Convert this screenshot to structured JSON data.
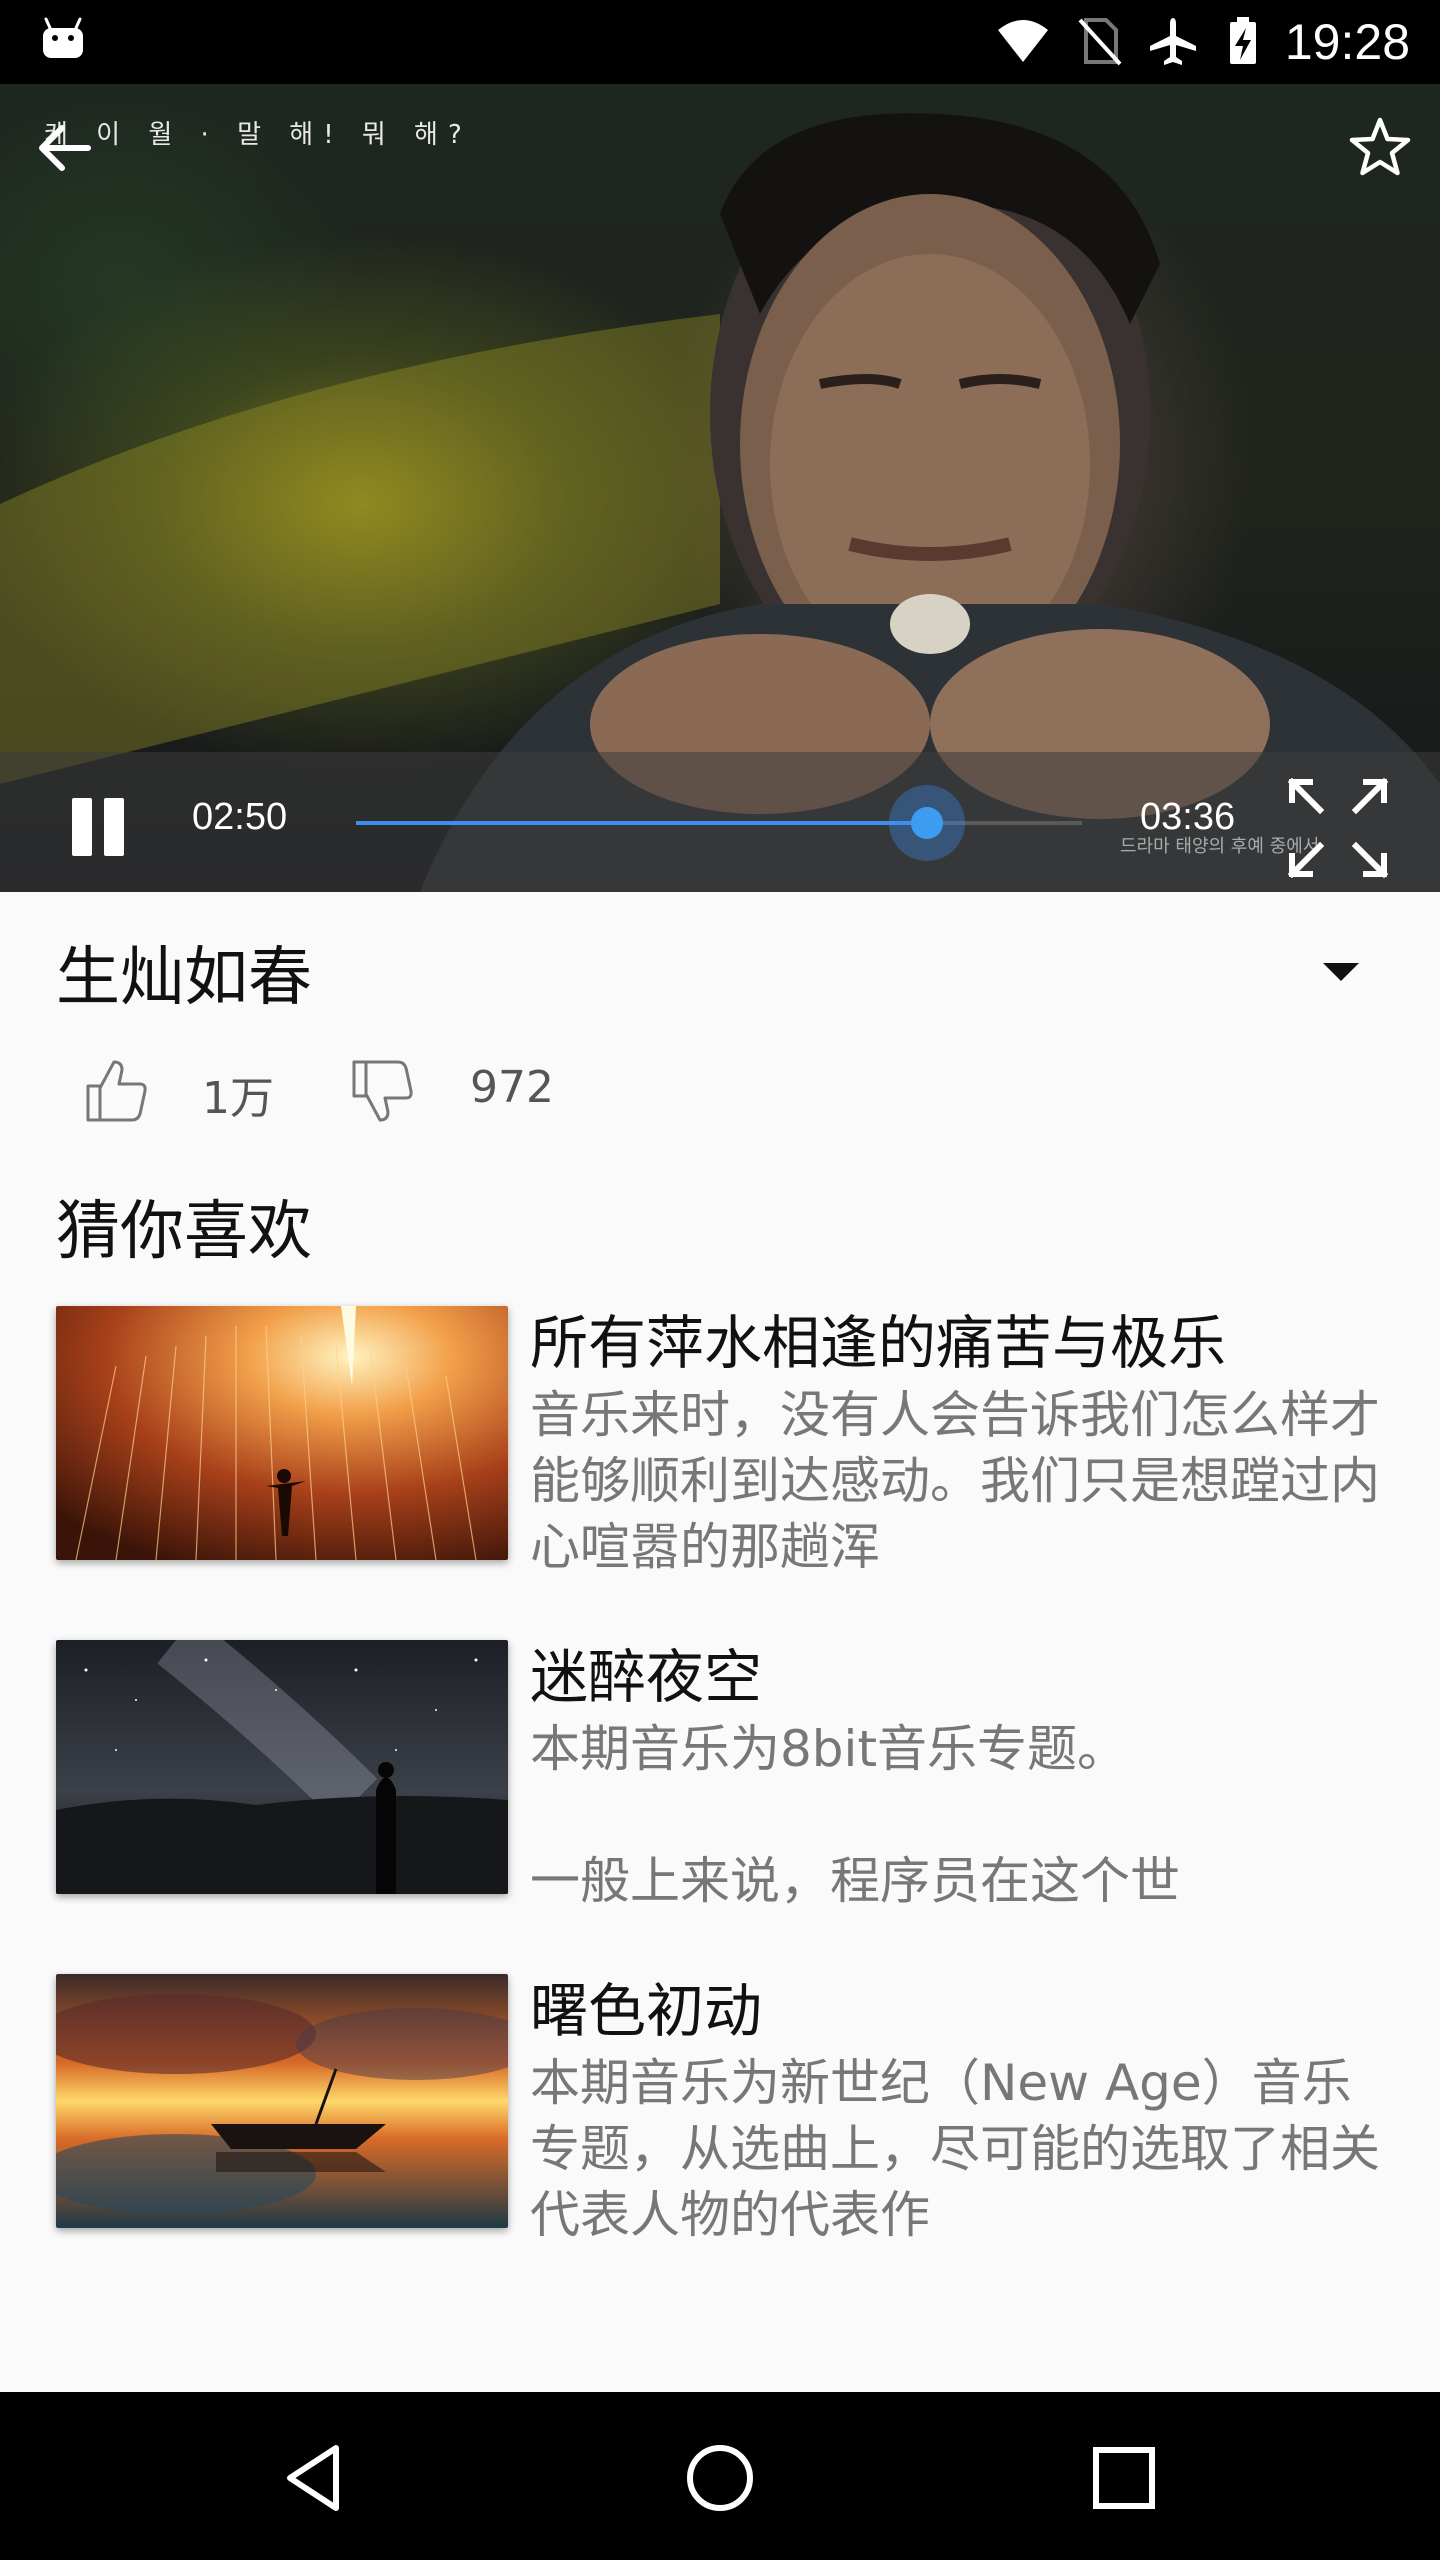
{
  "status_bar": {
    "time": "19:28",
    "icons": [
      "android-icon",
      "wifi-icon",
      "no-sim-icon",
      "airplane-icon",
      "battery-charging-icon"
    ]
  },
  "player": {
    "subtitle_top": "케 이 월 · 말 해! 뭐 해?",
    "watermark": "드라마 태양의 후예 중에서",
    "current_time": "02:50",
    "total_time": "03:36",
    "progress": 0.787,
    "state": "playing"
  },
  "video": {
    "title": "生灿如春",
    "likes": "1万",
    "dislikes": "972"
  },
  "recommendations": {
    "heading": "猜你喜欢",
    "items": [
      {
        "title": "所有萍水相逢的痛苦与极乐",
        "description": "音乐来时，没有人会告诉我们怎么样才能够顺利到达感动。我们只是想蹚过内心喧嚣的那趟浑",
        "thumbnail": "sparks-field-image"
      },
      {
        "title": "迷醉夜空",
        "description": "本期音乐为8bit音乐专题。\n\n一般上来说，程序员在这个世",
        "thumbnail": "night-sky-image"
      },
      {
        "title": "曙色初动",
        "description": "本期音乐为新世纪（New Age）音乐专题，从选曲上，尽可能的选取了相关代表人物的代表作",
        "thumbnail": "sunset-boat-image"
      }
    ]
  },
  "colors": {
    "accent": "#3d8ef0",
    "background": "#fafafa",
    "secondary_text": "#777777"
  }
}
